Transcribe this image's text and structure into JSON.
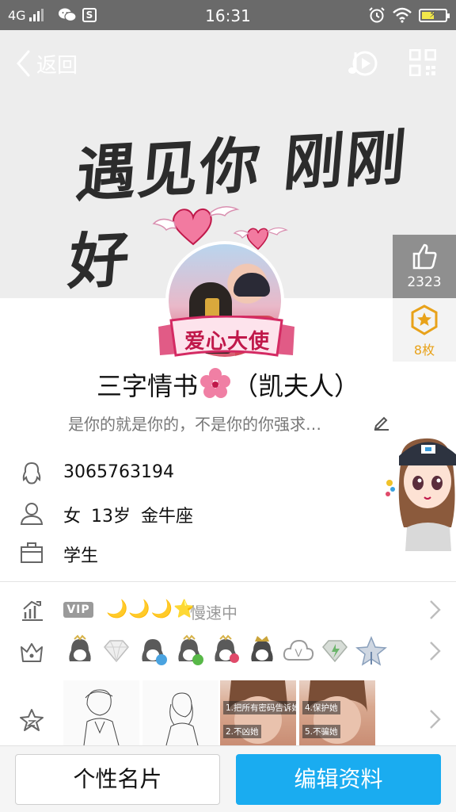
{
  "status_bar": {
    "network": "4G",
    "time": "16:31",
    "battery_level": 0.55,
    "colors": {
      "bg": "#6a6a6a",
      "battery": "#f2e84a"
    }
  },
  "nav": {
    "back_label": "返回"
  },
  "cover": {
    "calligraphy": "遇见你 刚刚好"
  },
  "likes": {
    "count": "2323"
  },
  "medals": {
    "count": "8枚"
  },
  "avatar_badge": {
    "text": "爱心大使"
  },
  "profile": {
    "nickname_left": "三字情书",
    "nickname_right": "（凯夫人）",
    "signature": "是你的就是你的，不是你的你强求…"
  },
  "info": {
    "qq_number": "3065763194",
    "gender_age_sign": "女  13岁  金牛座",
    "occupation": "学生"
  },
  "vip_row": {
    "vip_tag": "VIP",
    "level_moons": "🌙🌙🌙⭐",
    "speed_status": "慢速中"
  },
  "photos": {
    "caption_1": "1.把所有密码告诉她",
    "caption_2": "2.不凶她",
    "caption_3": "4.保护她",
    "caption_4": "5.不骗她"
  },
  "bottom_bar": {
    "card_label": "个性名片",
    "edit_label": "编辑资料"
  },
  "colors": {
    "accent_blue": "#1aacf0",
    "medal_gold": "#e8a21a",
    "badge_pink": "#c0184a"
  }
}
